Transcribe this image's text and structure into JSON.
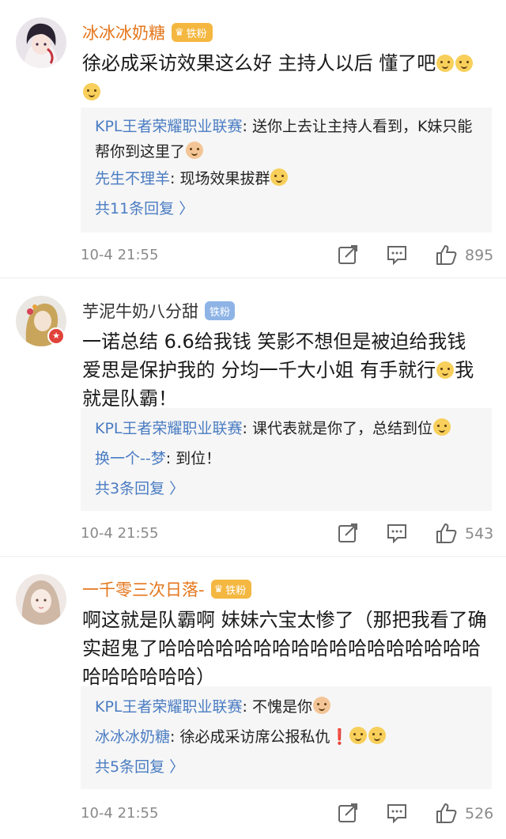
{
  "comments": [
    {
      "username": "冰冰冰奶糖",
      "fan_badge": "铁粉",
      "text_parts": [
        "徐必成采访效果这么好 主持人以后 懂了吧"
      ],
      "replies": [
        {
          "author": "KPL王者荣耀职业联赛",
          "text": "送你上去让主持人看到，K妹只能帮你到这里了"
        },
        {
          "author": "先生不理羊",
          "text": "现场效果拔群"
        }
      ],
      "reply_count": "共11条回复 〉",
      "time": "10-4 21:55",
      "likes": "895"
    },
    {
      "username": "芋泥牛奶八分甜",
      "fan_badge": "铁粉",
      "text_parts": [
        "一诺总结 6.6给我钱 笑影不想但是被迫给我钱 爱思是保护我的 分均一千大小姐 有手就行",
        "我就是队霸！"
      ],
      "replies": [
        {
          "author": "KPL王者荣耀职业联赛",
          "text": "课代表就是你了，总结到位"
        },
        {
          "author": "换一个--梦",
          "text": "到位！"
        }
      ],
      "reply_count": "共3条回复 〉",
      "time": "10-4 21:55",
      "likes": "543"
    },
    {
      "username": "一千零三次日落-",
      "fan_badge": "铁粉",
      "text_parts": [
        "啊这就是队霸啊 妹妹六宝太惨了（那把我看了确实超鬼了哈哈哈哈哈哈哈哈哈哈哈哈哈哈哈哈哈哈哈哈哈哈哈）"
      ],
      "replies": [
        {
          "author": "KPL王者荣耀职业联赛",
          "text": "不愧是你"
        },
        {
          "author": "冰冰冰奶糖",
          "text": "徐必成采访席公报私仇"
        }
      ],
      "reply_count": "共5条回复 〉",
      "time": "10-4 21:55",
      "likes": "526"
    }
  ],
  "reply_separator": ": ",
  "verified_glyph": "★",
  "crown_glyph": "♛",
  "exclaim_glyph": "❗",
  "colors": {
    "username_orange": "#e4761c",
    "reply_author_blue": "#4a7cc2",
    "fan_badge_gold": "#f4b740",
    "fan_badge_blue": "#8eb4e6",
    "reply_box_bg": "#f6f6f6",
    "meta_gray": "#8a8a8a"
  },
  "icons": [
    "share-icon",
    "comment-icon",
    "like-icon",
    "emoji-doge-icon",
    "emoji-cat-icon"
  ]
}
